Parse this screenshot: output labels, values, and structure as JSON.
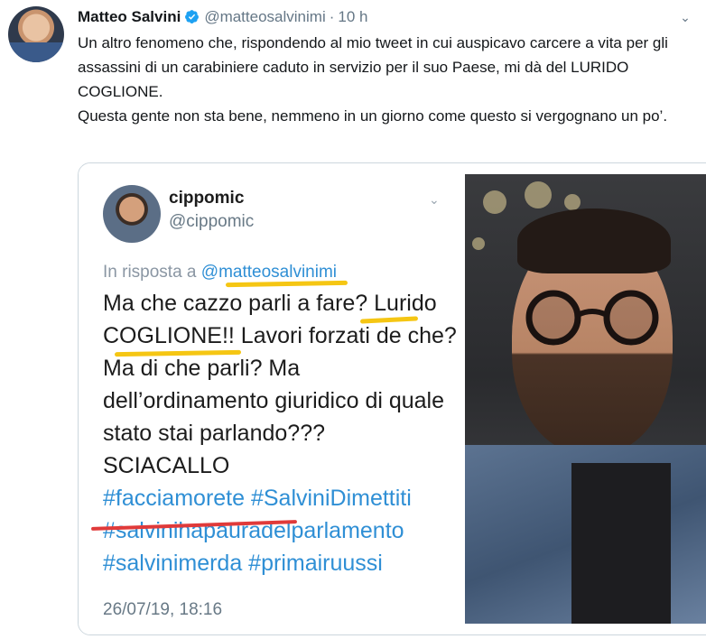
{
  "tweet": {
    "author_name": "Matteo Salvini",
    "author_handle": "@matteosalvinimi",
    "separator": "·",
    "time": "10 h",
    "text_paragraph_1": "Un altro fenomeno che, rispondendo al mio tweet in cui auspicavo carcere a vita per gli assassini di un carabiniere caduto in servizio per il suo Paese, mi dà del LURIDO COGLIONE.",
    "text_paragraph_2": "Questa gente non sta bene, nemmeno in un giorno come questo si vergognano un po’."
  },
  "embedded": {
    "name": "cippomic",
    "handle": "@cippomic",
    "reply_prefix": "In risposta a ",
    "reply_mention": "@matteosalvinimi",
    "lines": [
      "Ma che cazzo parli a fare? Lurido",
      "COGLIONE!! Lavori forzati de che?",
      "Ma di che parli? Ma",
      "dell’ordinamento giuridico di quale",
      "stato stai parlando???",
      "SCIACALLO"
    ],
    "hashtags_line_1": "#facciamorete #SalviniDimettiti",
    "hashtags_line_2": "#salvinihapauradelparlamento",
    "hashtags_line_3": "#salvinimerda #primairuussi",
    "date": "26/07/19, 18:16"
  },
  "colors": {
    "link_blue": "#2f8fd5",
    "highlight_yellow": "#f5c613",
    "underline_red": "#e03a3a"
  },
  "icons": [
    "verified-badge-icon",
    "chevron-down-icon"
  ]
}
